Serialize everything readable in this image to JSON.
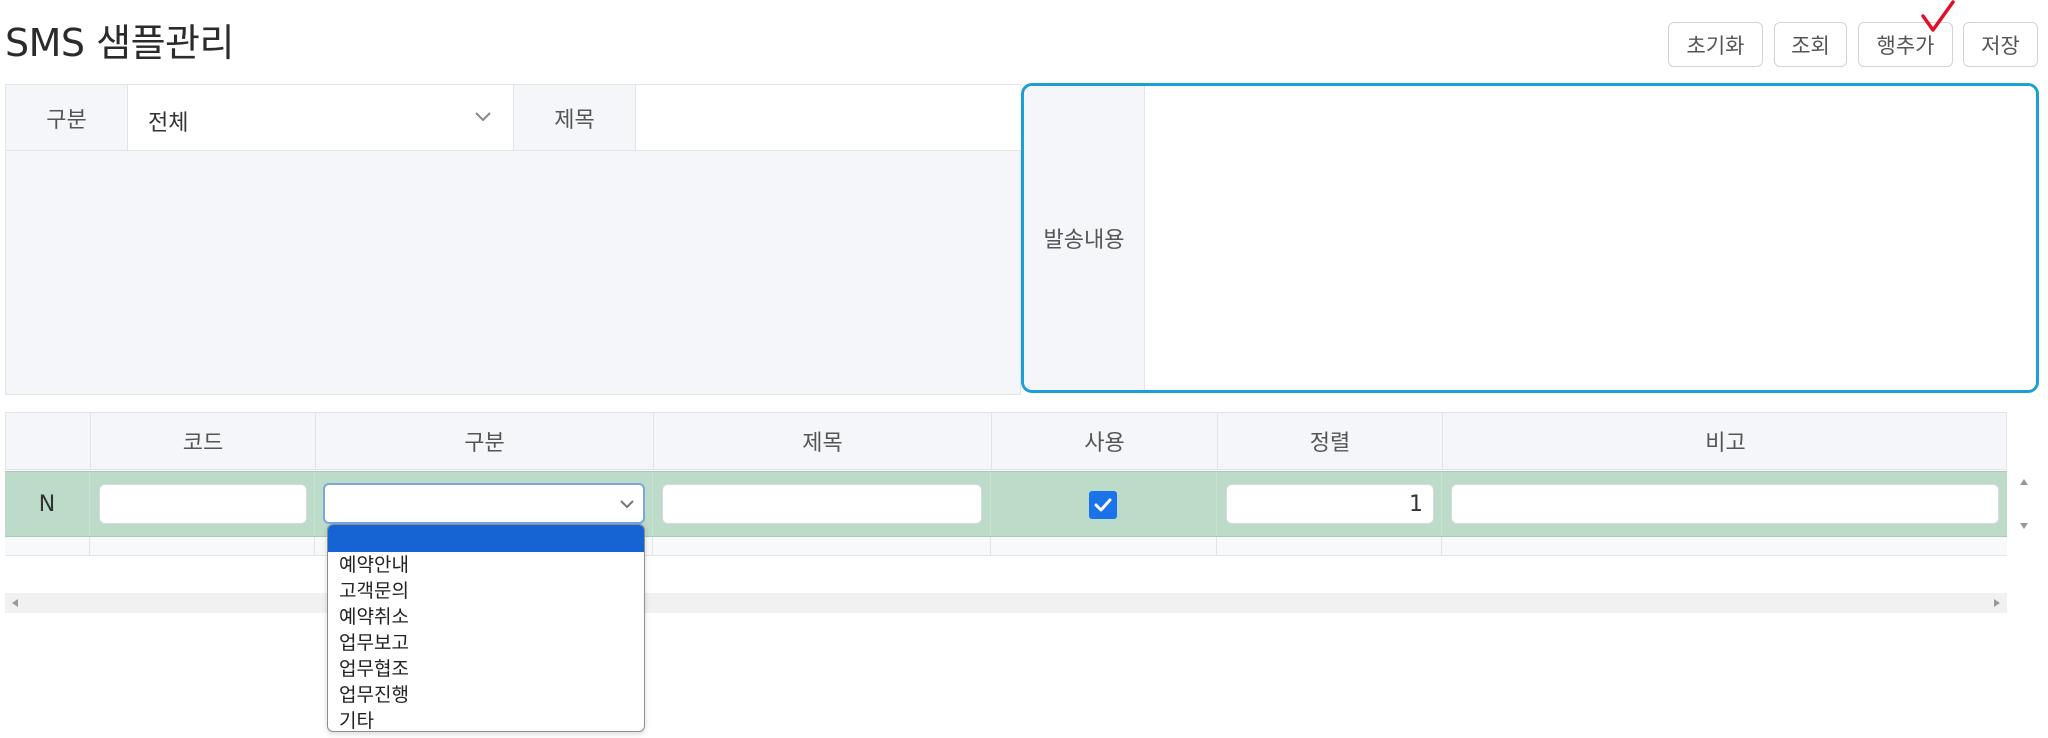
{
  "page": {
    "title": "SMS 샘플관리"
  },
  "toolbar": {
    "reset_label": "초기화",
    "search_label": "조회",
    "add_row_label": "행추가",
    "save_label": "저장"
  },
  "form": {
    "category_label": "구분",
    "category_value": "전체",
    "title_label": "제목",
    "title_value": "",
    "content_label": "발송내용",
    "content_value": ""
  },
  "grid": {
    "columns": [
      "",
      "코드",
      "구분",
      "제목",
      "사용",
      "정렬",
      "비고"
    ],
    "rows": [
      {
        "status": "N",
        "code": "",
        "category": "",
        "title": "",
        "use": true,
        "sort": "1",
        "note": ""
      }
    ]
  },
  "dropdown": {
    "options": [
      "",
      "예약안내",
      "고객문의",
      "예약취소",
      "업무보고",
      "업무협조",
      "업무진행",
      "기타"
    ],
    "highlighted_index": 0
  },
  "colors": {
    "accent": "#1a9fd6",
    "row_highlight": "#bcdcc9",
    "checkbox": "#1a73e8",
    "dropdown_selected": "#1664d3",
    "annotation_check": "#e0102b"
  },
  "icons": [
    "chevron-down-icon",
    "check-icon",
    "scroll-arrow-up-icon",
    "scroll-arrow-down-icon",
    "scroll-arrow-left-icon",
    "scroll-arrow-right-icon",
    "annotation-checkmark-icon"
  ]
}
